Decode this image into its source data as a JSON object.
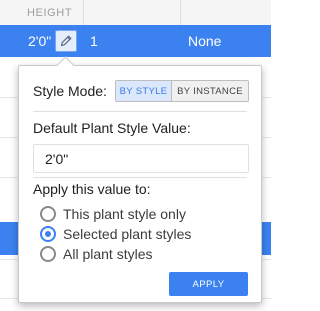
{
  "table": {
    "column_header": "HEIGHT",
    "selected_row": {
      "height": "2'0\"",
      "count": "1",
      "style": "None"
    }
  },
  "popover": {
    "style_mode_label": "Style Mode:",
    "style_mode_options": [
      "BY STYLE",
      "BY INSTANCE"
    ],
    "style_mode_selected": "BY STYLE",
    "default_value_label": "Default Plant Style Value:",
    "default_value": "2'0\"",
    "apply_to_label": "Apply this value to:",
    "apply_options": [
      {
        "label": "This plant style only",
        "selected": false
      },
      {
        "label": "Selected plant styles",
        "selected": true
      },
      {
        "label": "All plant styles",
        "selected": false
      }
    ],
    "apply_button": "APPLY"
  },
  "colors": {
    "accent": "#3b82f0",
    "selected_row": "#3b82f0",
    "segment_active_bg": "#dbe7fb"
  },
  "icons": {
    "edit": "pencil-icon"
  }
}
